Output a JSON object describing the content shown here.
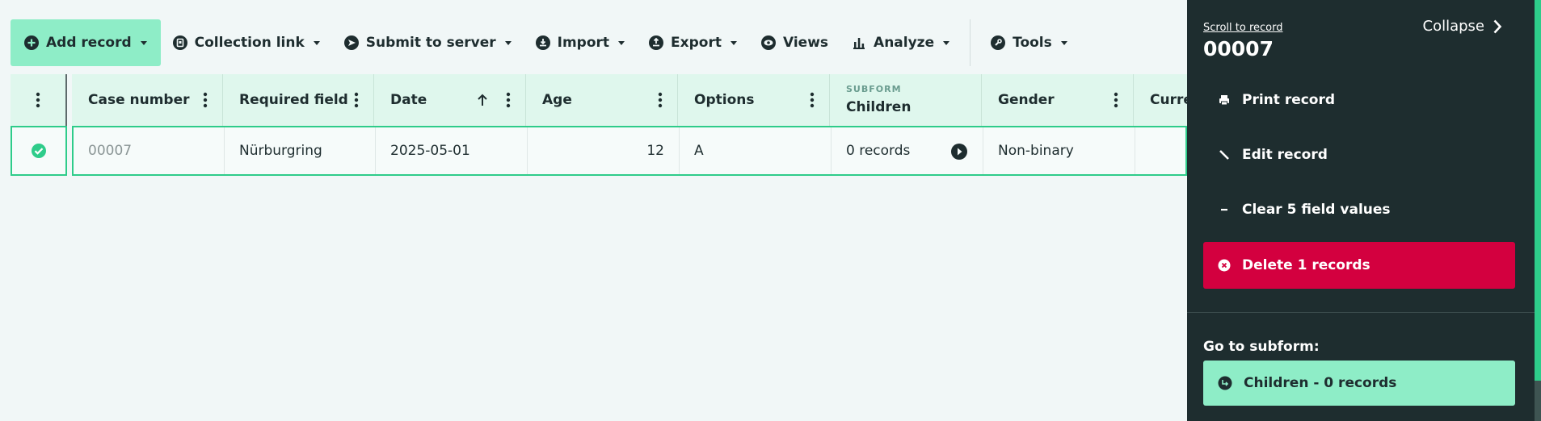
{
  "toolbar": {
    "add_record": "Add record",
    "collection_link": "Collection link",
    "submit_to_server": "Submit to server",
    "import": "Import",
    "export": "Export",
    "views": "Views",
    "analyze": "Analyze",
    "tools": "Tools"
  },
  "table": {
    "columns": [
      {
        "label": "Case number"
      },
      {
        "label": "Required field"
      },
      {
        "label": "Date",
        "sort": "ascending"
      },
      {
        "label": "Age"
      },
      {
        "label": "Options"
      },
      {
        "label": "Children",
        "sublabel": "SUBFORM"
      },
      {
        "label": "Gender"
      },
      {
        "label": "Curre"
      }
    ],
    "row": {
      "selected": true,
      "case_number": "00007",
      "required_field": "Nürburgring",
      "date": "2025-05-01",
      "age": "12",
      "options": "A",
      "children": "0 records",
      "gender": "Non-binary",
      "current": ""
    }
  },
  "panel": {
    "scroll_link": "Scroll to record",
    "record_id": "00007",
    "collapse": "Collapse",
    "actions": {
      "print": "Print record",
      "edit": "Edit record",
      "clear": "Clear 5 field values",
      "delete": "Delete 1 records"
    },
    "goto_label": "Go to subform:",
    "goto_button": "Children - 0 records"
  },
  "colors": {
    "primary": "#8eedc7",
    "accent": "#2ecc8a",
    "panel_bg": "#1e2d2f",
    "danger": "#d3003f",
    "header_bg": "#dff7ed"
  }
}
